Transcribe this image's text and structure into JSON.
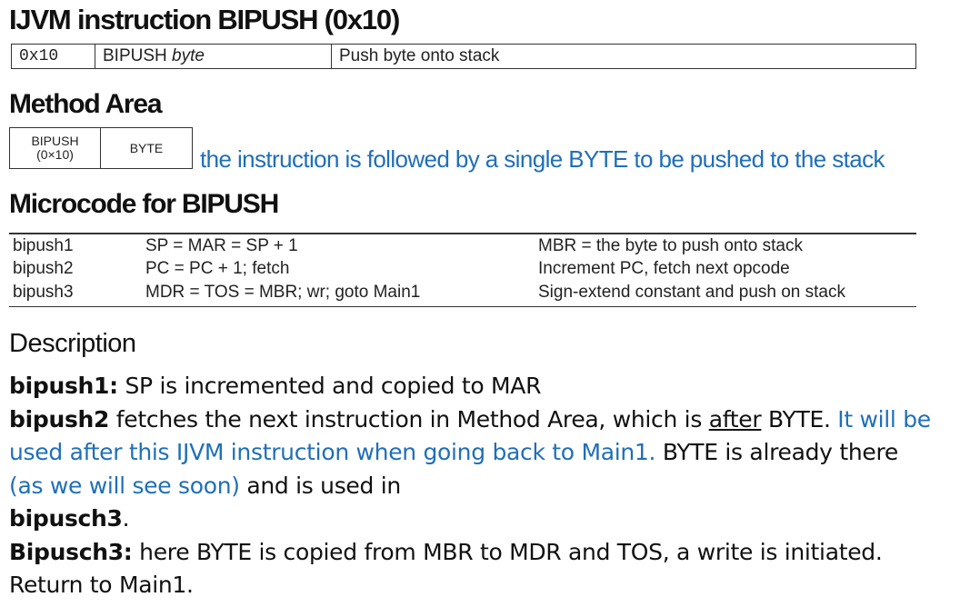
{
  "title": "IJVM instruction BIPUSH (0x10)",
  "instruction_table": {
    "opcode": "0x10",
    "mnemonic": "BIPUSH",
    "operand": "byte",
    "description": "Push byte onto stack"
  },
  "method_area": {
    "heading": "Method Area",
    "cell1_line1": "BIPUSH",
    "cell1_line2": "(0×10)",
    "cell2": "BYTE",
    "note": "the instruction is followed by a single BYTE to be pushed to the stack",
    "note_color": "#1f6fb8"
  },
  "microcode": {
    "heading": "Microcode for BIPUSH",
    "rows": [
      {
        "label": "bipush1",
        "ops": "SP = MAR = SP + 1",
        "comment": "MBR = the byte to push onto stack"
      },
      {
        "label": "bipush2",
        "ops": "PC = PC + 1; fetch",
        "comment": "Increment PC, fetch next opcode"
      },
      {
        "label": "bipush3",
        "ops": "MDR = TOS = MBR; wr; goto Main1",
        "comment": "Sign-extend constant and push on stack"
      }
    ]
  },
  "description": {
    "heading": "Description",
    "p1_bold": "bipush1:",
    "p1_text": " SP is incremented and copied to MAR",
    "p2_bold": "bipush2",
    "p2_text1": " fetches the next instruction in Method Area, which is ",
    "p2_underline": "after",
    "p2_text2": " BYTE. ",
    "p2_blue1": "It will be used after this IJVM instruction when going back to Main1.",
    "p2_text3": " BYTE is already there ",
    "p2_blue2": "(as we will see soon)",
    "p2_text4": " and is used in ",
    "p2_bold2": "bipusch3",
    "p2_text5": ".",
    "p3_bold": "Bipusch3:",
    "p3_text": " here BYTE is copied from MBR to MDR and TOS, a write is initiated. Return to Main1."
  }
}
